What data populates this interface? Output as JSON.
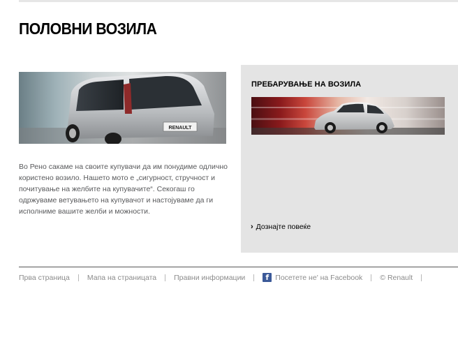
{
  "page": {
    "title": "ПОЛОВНИ ВОЗИЛА"
  },
  "intro": {
    "text": "Во Рено сакаме на своите купувачи да им понудиме одлично користено возило. Нашето мото е „сигурност, стручност и почитување на желбите на купувачите“. Секогаш го одржуваме ветувањето на купувачот и настојуваме да ги исполниме вашите желби и можности."
  },
  "hero_image": {
    "badge": "RENAULT"
  },
  "panel": {
    "title": "ПРЕБАРУВАЊЕ НА ВОЗИЛА",
    "link_label": "Дознајте повеќе",
    "link_icon": "chevron-right-icon"
  },
  "footer": {
    "links": [
      "Прва страница",
      "Мапа на страницата",
      "Правни информации",
      "Посетете не' на Facebook",
      "© Renault"
    ],
    "facebook_icon": "facebook-icon",
    "facebook_color": "#3b5998"
  }
}
